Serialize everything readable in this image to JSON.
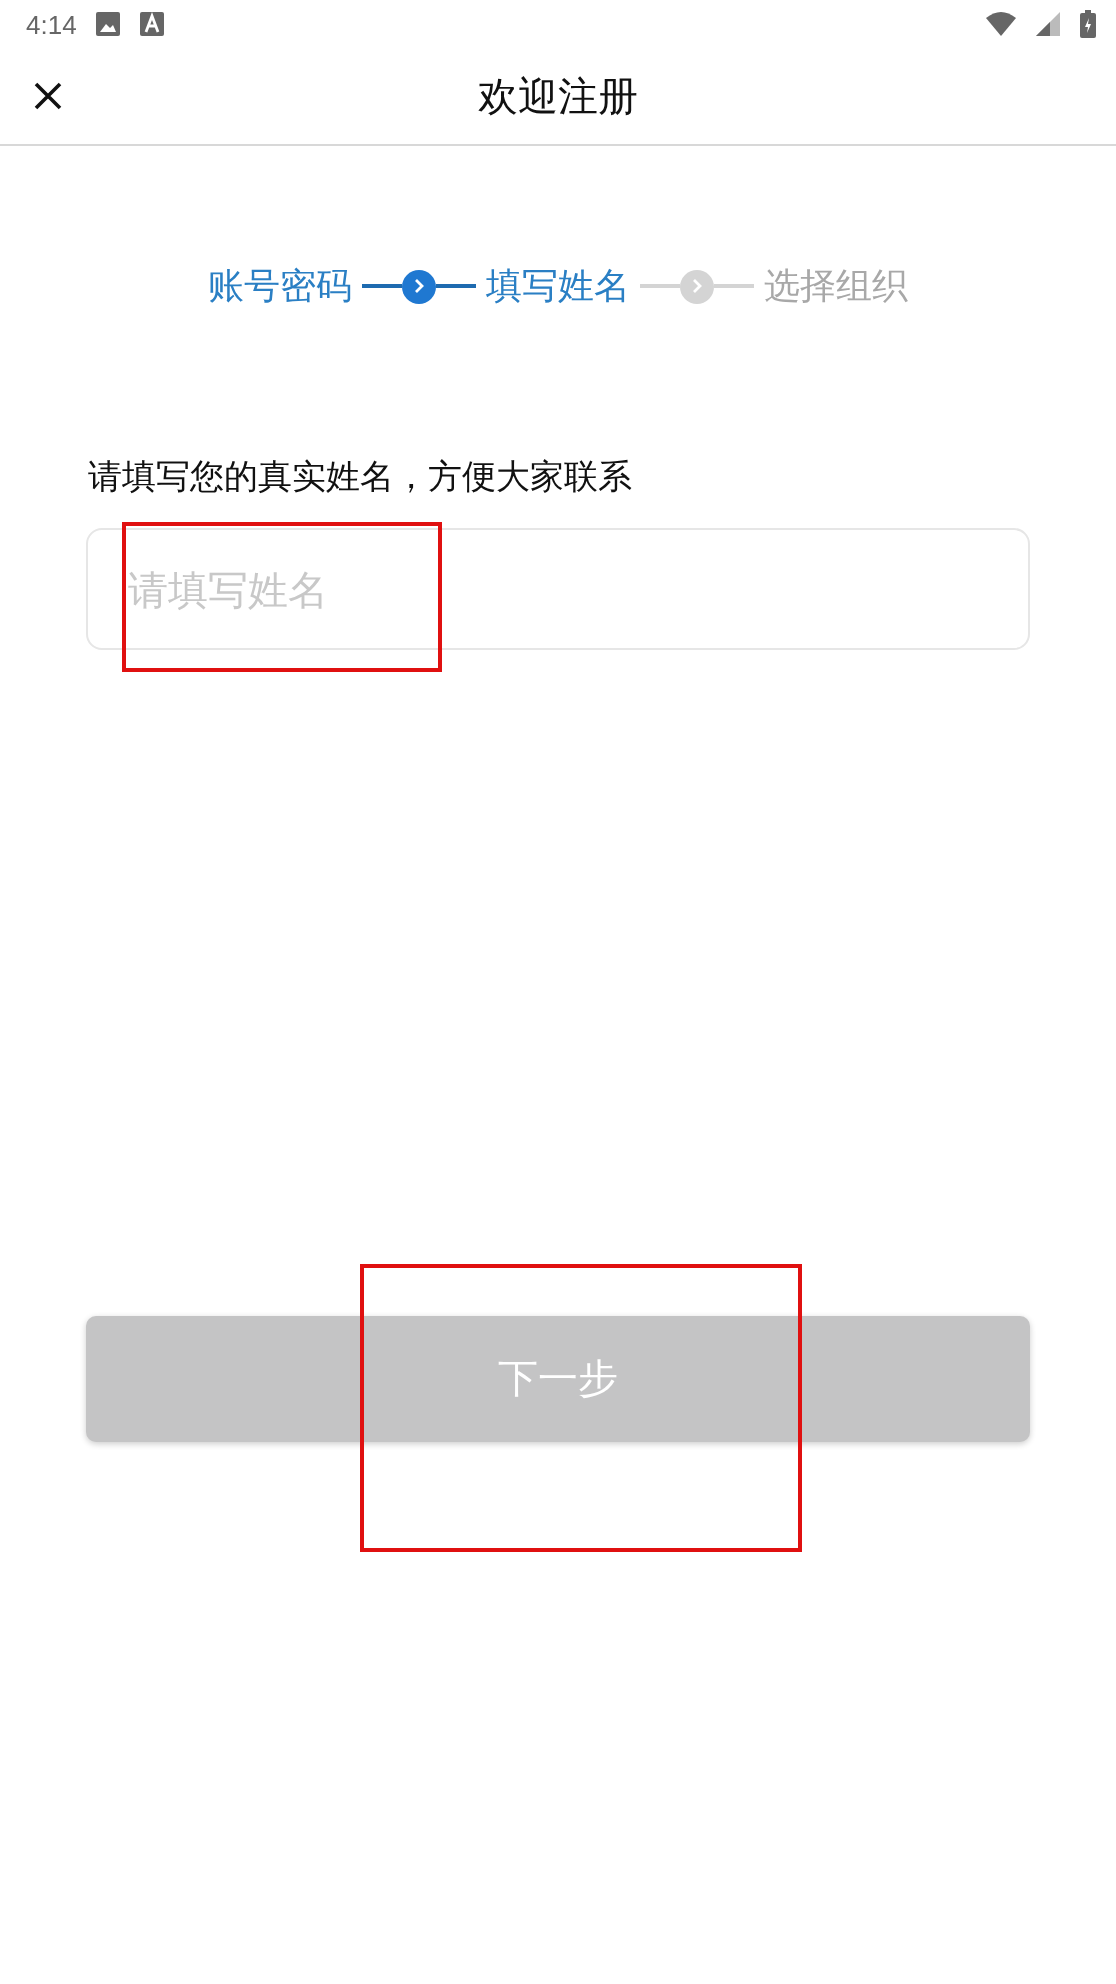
{
  "status_bar": {
    "time": "4:14"
  },
  "header": {
    "title": "欢迎注册"
  },
  "steps": [
    {
      "label": "账号密码",
      "active": true
    },
    {
      "label": "填写姓名",
      "active": true
    },
    {
      "label": "选择组织",
      "active": false
    }
  ],
  "prompt": "请填写您的真实姓名，方便大家联系",
  "name_field": {
    "placeholder": "请填写姓名",
    "highlighted": true
  },
  "next_button": {
    "label": "下一步",
    "disabled": true,
    "highlighted": true
  }
}
